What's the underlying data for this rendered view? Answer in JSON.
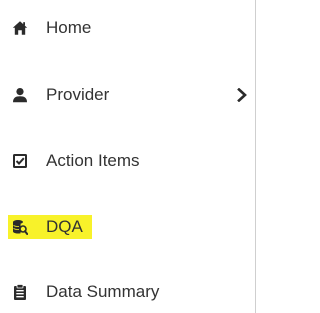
{
  "sidebar": {
    "items": [
      {
        "label": "Home",
        "icon": "home-icon"
      },
      {
        "label": "Provider",
        "icon": "user-icon",
        "has_submenu": true
      },
      {
        "label": "Action Items",
        "icon": "checkbox-icon"
      },
      {
        "label": "DQA",
        "icon": "database-search-icon",
        "highlighted": true
      },
      {
        "label": "Data Summary",
        "icon": "clipboard-icon"
      }
    ]
  },
  "colors": {
    "text": "#333333",
    "icon": "#2b2b2b",
    "highlight": "#f8f22a",
    "border": "#cfcfcf"
  }
}
